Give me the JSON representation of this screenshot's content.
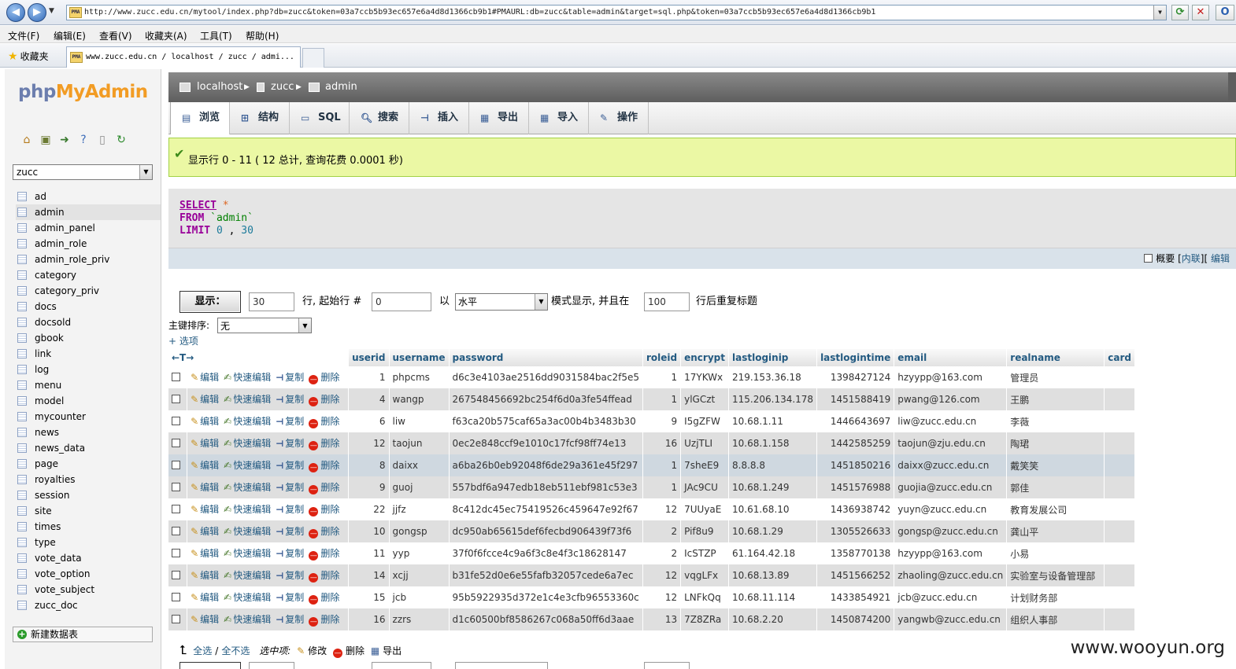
{
  "browser": {
    "address": "http://www.zucc.edu.cn/mytool/index.php?db=zucc&token=03a7ccb5b93ec657e6a4d8d1366cb9b1#PMAURL:db=zucc&table=admin&target=sql.php&token=03a7ccb5b93ec657e6a4d8d1366cb9b1",
    "favicon_text": "PMA",
    "menu": [
      "文件(F)",
      "编辑(E)",
      "查看(V)",
      "收藏夹(A)",
      "工具(T)",
      "帮助(H)"
    ],
    "favorites_label": "收藏夹",
    "tab_title": "www.zucc.edu.cn / localhost / zucc / admi..."
  },
  "sidebar": {
    "logo_php": "php",
    "logo_myadmin": "MyAdmin",
    "db_selected": "zucc",
    "tables": [
      "ad",
      "admin",
      "admin_panel",
      "admin_role",
      "admin_role_priv",
      "category",
      "category_priv",
      "docs",
      "docsold",
      "gbook",
      "link",
      "log",
      "menu",
      "model",
      "mycounter",
      "news",
      "news_data",
      "page",
      "royalties",
      "session",
      "site",
      "times",
      "type",
      "vote_data",
      "vote_option",
      "vote_subject",
      "zucc_doc"
    ],
    "selected_table": "admin",
    "new_db_label": "新建数据表"
  },
  "breadcrumb": {
    "server": "localhost",
    "database": "zucc",
    "table": "admin"
  },
  "tabs": [
    "浏览",
    "结构",
    "SQL",
    "搜索",
    "插入",
    "导出",
    "导入",
    "操作"
  ],
  "active_tab": "浏览",
  "message": "显示行 0 - 11 ( 12 总计, 查询花费 0.0001 秒)",
  "sql": {
    "select_kw": "SELECT",
    "star": "*",
    "from_kw": "FROM",
    "table_literal": "`admin`",
    "limit_kw": "LIMIT",
    "limit_a": "0",
    "limit_sep": ",",
    "limit_b": "30"
  },
  "sqlbar": {
    "profile_label": "概要",
    "inline_link": "内联",
    "edit_link": "编辑"
  },
  "navform": {
    "show_button": "显示：",
    "rows_value": "30",
    "rows_label": "行, 起始行 #",
    "start_value": "0",
    "mode_prefix": "以",
    "mode_value": "水平",
    "mode_label": "模式显示, 并且在",
    "repeat_value": "100",
    "repeat_label": "行后重复标题",
    "sort_label": "主键排序:",
    "sort_value": "无",
    "options_link": "+ 选项"
  },
  "grid": {
    "columns": [
      "userid",
      "username",
      "password",
      "roleid",
      "encrypt",
      "lastloginip",
      "lastlogintime",
      "email",
      "realname",
      "card"
    ],
    "actions": {
      "edit": "编辑",
      "quick_edit": "快速编辑",
      "copy": "复制",
      "delete": "删除"
    },
    "rows": [
      [
        "1",
        "phpcms",
        "d6c3e4103ae2516dd9031584bac2f5e5",
        "1",
        "17YKWx",
        "219.153.36.18",
        "1398427124",
        "hzyypp@163.com",
        "管理员",
        ""
      ],
      [
        "4",
        "wangp",
        "267548456692bc254f6d0a3fe54ffead",
        "1",
        "ylGCzt",
        "115.206.134.178",
        "1451588419",
        "pwang@126.com",
        "王鹏",
        ""
      ],
      [
        "6",
        "liw",
        "f63ca20b575caf65a3ac00b4b3483b30",
        "9",
        "I5gZFW",
        "10.68.1.11",
        "1446643697",
        "liw@zucc.edu.cn",
        "李薇",
        ""
      ],
      [
        "12",
        "taojun",
        "0ec2e848ccf9e1010c17fcf98ff74e13",
        "16",
        "UzjTLI",
        "10.68.1.158",
        "1442585259",
        "taojun@zju.edu.cn",
        "陶珺",
        ""
      ],
      [
        "8",
        "daixx",
        "a6ba26b0eb92048f6de29a361e45f297",
        "1",
        "7sheE9",
        "8.8.8.8",
        "1451850216",
        "daixx@zucc.edu.cn",
        "戴笑笑",
        ""
      ],
      [
        "9",
        "guoj",
        "557bdf6a947edb18eb511ebf981c53e3",
        "1",
        "JAc9CU",
        "10.68.1.249",
        "1451576988",
        "guojia@zucc.edu.cn",
        "郭佳",
        ""
      ],
      [
        "22",
        "jjfz",
        "8c412dc45ec75419526c459647e92f67",
        "12",
        "7UUyaE",
        "10.61.68.10",
        "1436938742",
        "yuyn@zucc.edu.cn",
        "教育发展公司",
        ""
      ],
      [
        "10",
        "gongsp",
        "dc950ab65615def6fecbd906439f73f6",
        "2",
        "Pif8u9",
        "10.68.1.29",
        "1305526633",
        "gongsp@zucc.edu.cn",
        "龚山平",
        ""
      ],
      [
        "11",
        "yyp",
        "37f0f6fcce4c9a6f3c8e4f3c18628147",
        "2",
        "IcSTZP",
        "61.164.42.18",
        "1358770138",
        "hzyypp@163.com",
        "小易",
        ""
      ],
      [
        "14",
        "xcjj",
        "b31fe52d0e6e55fafb32057cede6a7ec",
        "12",
        "vqgLFx",
        "10.68.13.89",
        "1451566252",
        "zhaoling@zucc.edu.cn",
        "实验室与设备管理部",
        ""
      ],
      [
        "15",
        "jcb",
        "95b5922935d372e1c4e3cfb96553360c",
        "12",
        "LNFkQq",
        "10.68.11.114",
        "1433854921",
        "jcb@zucc.edu.cn",
        "计划财务部",
        ""
      ],
      [
        "16",
        "zzrs",
        "d1c60500bf8586267c068a50ff6d3aae",
        "13",
        "7Z8ZRa",
        "10.68.2.20",
        "1450874200",
        "yangwb@zucc.edu.cn",
        "组织人事部",
        ""
      ]
    ],
    "highlight_row": 4
  },
  "bottom": {
    "select_all": "全选",
    "sep": "/",
    "deselect_all": "全不选",
    "with_selected": "选中项:",
    "modify": "修改",
    "delete": "删除",
    "export": "导出"
  },
  "watermark": "www.wooyun.org",
  "colors": {
    "accent": "#235a81",
    "success_bg": "#ebf8a4",
    "logo_php": "#6c7eae",
    "logo_myadmin": "#f29c24"
  }
}
